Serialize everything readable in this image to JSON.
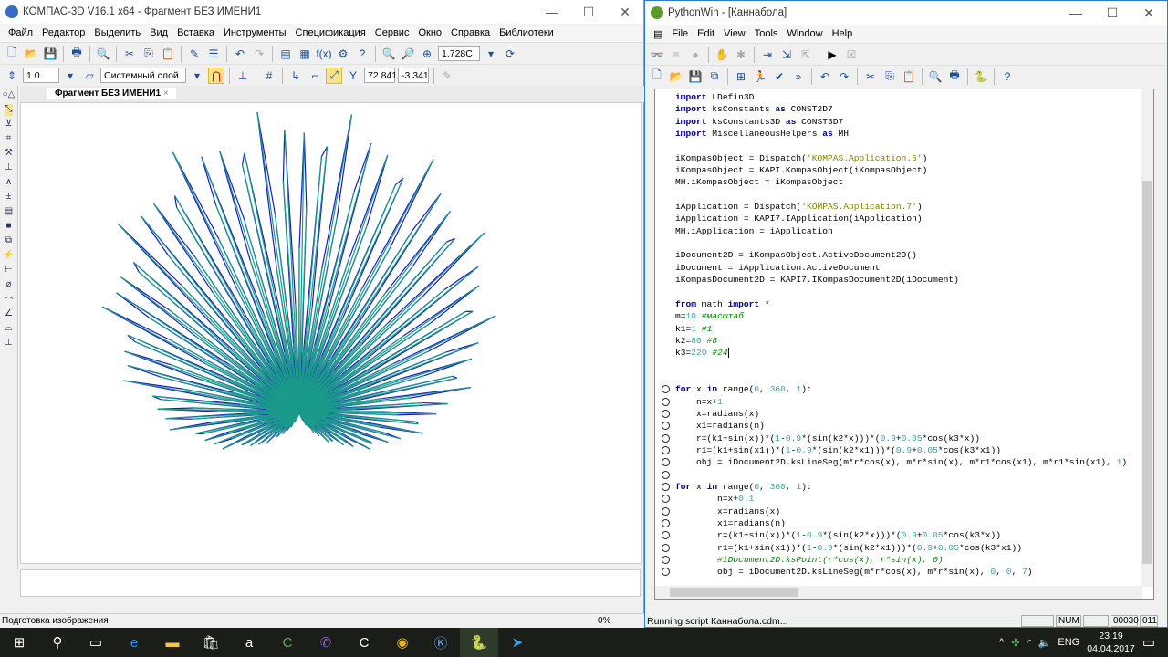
{
  "kompas": {
    "title": "КОМПАС-3D V16.1 x64 - Фрагмент БЕЗ ИМЕНИ1",
    "menu": [
      "Файл",
      "Редактор",
      "Выделить",
      "Вид",
      "Вставка",
      "Инструменты",
      "Спецификация",
      "Сервис",
      "Окно",
      "Справка",
      "Библиотеки"
    ],
    "zoom": "1.728С",
    "line_step": "1.0",
    "layer": "Системный слой",
    "coord_x": "72.841",
    "coord_y": "-3.341",
    "doc_tab": "Фрагмент БЕЗ ИМЕНИ1",
    "status": "Подготовка изображения",
    "progress": "0%",
    "colors": {
      "teal": "#1a9a8a",
      "blue": "#1a1ab8"
    }
  },
  "pywin": {
    "title": "PythonWin - [Каннабола]",
    "menu": [
      "File",
      "Edit",
      "View",
      "Tools",
      "Window",
      "Help"
    ],
    "status": "Running script Каннабола.cdm...",
    "panes": [
      "",
      "NUM",
      "",
      "00030",
      "011"
    ],
    "params": {
      "m": 10,
      "k1": 1,
      "k2": 80,
      "k3": 220
    },
    "code": [
      {
        "bp": false,
        "s": [
          [
            "kw",
            "import"
          ],
          [
            "pl",
            " LDefin3D"
          ]
        ]
      },
      {
        "bp": false,
        "s": [
          [
            "kw",
            "import"
          ],
          [
            "pl",
            " ksConstants "
          ],
          [
            "kw",
            "as"
          ],
          [
            "pl",
            " CONST2D7"
          ]
        ]
      },
      {
        "bp": false,
        "s": [
          [
            "kw",
            "import"
          ],
          [
            "pl",
            " ksConstants3D "
          ],
          [
            "kw",
            "as"
          ],
          [
            "pl",
            " CONST3D7"
          ]
        ]
      },
      {
        "bp": false,
        "s": [
          [
            "kw",
            "import"
          ],
          [
            "pl",
            " MiscellaneousHelpers "
          ],
          [
            "kw",
            "as"
          ],
          [
            "pl",
            " MH"
          ]
        ]
      },
      {
        "bp": false,
        "s": []
      },
      {
        "bp": false,
        "s": [
          [
            "pl",
            "iKompasObject = Dispatch("
          ],
          [
            "str",
            "'KOMPAS.Application.5'"
          ],
          [
            "pl",
            ")"
          ]
        ]
      },
      {
        "bp": false,
        "s": [
          [
            "pl",
            "iKompasObject = KAPI.KompasObject(iKompasObject)"
          ]
        ]
      },
      {
        "bp": false,
        "s": [
          [
            "pl",
            "MH.iKompasObject = iKompasObject"
          ]
        ]
      },
      {
        "bp": false,
        "s": []
      },
      {
        "bp": false,
        "s": [
          [
            "pl",
            "iApplication = Dispatch("
          ],
          [
            "str",
            "'KOMPAS.Application.7'"
          ],
          [
            "pl",
            ")"
          ]
        ]
      },
      {
        "bp": false,
        "s": [
          [
            "pl",
            "iApplication = KAPI7.IApplication(iApplication)"
          ]
        ]
      },
      {
        "bp": false,
        "s": [
          [
            "pl",
            "MH.iApplication = iApplication"
          ]
        ]
      },
      {
        "bp": false,
        "s": []
      },
      {
        "bp": false,
        "s": [
          [
            "pl",
            "iDocument2D = iKompasObject.ActiveDocument2D()"
          ]
        ]
      },
      {
        "bp": false,
        "s": [
          [
            "pl",
            "iDocument = iApplication.ActiveDocument"
          ]
        ]
      },
      {
        "bp": false,
        "s": [
          [
            "pl",
            "iKompasDocument2D = KAPI7.IKompasDocument2D(iDocument)"
          ]
        ]
      },
      {
        "bp": false,
        "s": []
      },
      {
        "bp": false,
        "s": [
          [
            "kw",
            "from"
          ],
          [
            "pl",
            " math "
          ],
          [
            "kw",
            "import"
          ],
          [
            "pl",
            " *"
          ]
        ]
      },
      {
        "bp": false,
        "s": [
          [
            "pl",
            "m="
          ],
          [
            "num",
            "10"
          ],
          [
            "pl",
            " "
          ],
          [
            "com",
            "#масштаб"
          ]
        ]
      },
      {
        "bp": false,
        "s": [
          [
            "pl",
            "k1="
          ],
          [
            "num",
            "1"
          ],
          [
            "pl",
            " "
          ],
          [
            "com",
            "#1"
          ]
        ]
      },
      {
        "bp": false,
        "s": [
          [
            "pl",
            "k2="
          ],
          [
            "num",
            "80"
          ],
          [
            "pl",
            " "
          ],
          [
            "com",
            "#8"
          ]
        ]
      },
      {
        "bp": false,
        "caret": true,
        "s": [
          [
            "pl",
            "k3="
          ],
          [
            "num",
            "220"
          ],
          [
            "pl",
            " "
          ],
          [
            "com",
            "#24"
          ]
        ]
      },
      {
        "bp": false,
        "s": []
      },
      {
        "bp": false,
        "s": []
      },
      {
        "bp": true,
        "s": [
          [
            "kw",
            "for"
          ],
          [
            "pl",
            " x "
          ],
          [
            "kw",
            "in"
          ],
          [
            "pl",
            " range("
          ],
          [
            "num",
            "0"
          ],
          [
            "pl",
            ", "
          ],
          [
            "num",
            "360"
          ],
          [
            "pl",
            ", "
          ],
          [
            "num",
            "1"
          ],
          [
            "pl",
            "):"
          ]
        ]
      },
      {
        "bp": true,
        "s": [
          [
            "pl",
            "    n=x+"
          ],
          [
            "num",
            "1"
          ]
        ]
      },
      {
        "bp": true,
        "s": [
          [
            "pl",
            "    x=radians(x)"
          ]
        ]
      },
      {
        "bp": true,
        "s": [
          [
            "pl",
            "    x1=radians(n)"
          ]
        ]
      },
      {
        "bp": true,
        "s": [
          [
            "pl",
            "    r=(k1+sin(x))*("
          ],
          [
            "num",
            "1"
          ],
          [
            "pl",
            "-"
          ],
          [
            "num",
            "0.9"
          ],
          [
            "pl",
            "*(sin(k2*x)))*("
          ],
          [
            "num",
            "0.9"
          ],
          [
            "pl",
            "+"
          ],
          [
            "num",
            "0.05"
          ],
          [
            "pl",
            "*cos(k3*x))"
          ]
        ]
      },
      {
        "bp": true,
        "s": [
          [
            "pl",
            "    r1=(k1+sin(x1))*("
          ],
          [
            "num",
            "1"
          ],
          [
            "pl",
            "-"
          ],
          [
            "num",
            "0.9"
          ],
          [
            "pl",
            "*(sin(k2*x1)))*("
          ],
          [
            "num",
            "0.9"
          ],
          [
            "pl",
            "+"
          ],
          [
            "num",
            "0.05"
          ],
          [
            "pl",
            "*cos(k3*x1))"
          ]
        ]
      },
      {
        "bp": true,
        "s": [
          [
            "pl",
            "    obj = iDocument2D.ksLineSeg(m*r*cos(x), m*r*sin(x), m*r1*cos(x1), m*r1*sin(x1), "
          ],
          [
            "num",
            "1"
          ],
          [
            "pl",
            ")"
          ]
        ]
      },
      {
        "bp": true,
        "s": []
      },
      {
        "bp": true,
        "s": [
          [
            "kw",
            "for"
          ],
          [
            "pl",
            " x "
          ],
          [
            "kw",
            "in"
          ],
          [
            "pl",
            " range("
          ],
          [
            "num",
            "0"
          ],
          [
            "pl",
            ", "
          ],
          [
            "num",
            "360"
          ],
          [
            "pl",
            ", "
          ],
          [
            "num",
            "1"
          ],
          [
            "pl",
            "):"
          ]
        ]
      },
      {
        "bp": true,
        "s": [
          [
            "pl",
            "        n=x+"
          ],
          [
            "num",
            "0.1"
          ]
        ]
      },
      {
        "bp": true,
        "s": [
          [
            "pl",
            "        x=radians(x)"
          ]
        ]
      },
      {
        "bp": true,
        "s": [
          [
            "pl",
            "        x1=radians(n)"
          ]
        ]
      },
      {
        "bp": true,
        "s": [
          [
            "pl",
            "        r=(k1+sin(x))*("
          ],
          [
            "num",
            "1"
          ],
          [
            "pl",
            "-"
          ],
          [
            "num",
            "0.9"
          ],
          [
            "pl",
            "*(sin(k2*x)))*("
          ],
          [
            "num",
            "0.9"
          ],
          [
            "pl",
            "+"
          ],
          [
            "num",
            "0.05"
          ],
          [
            "pl",
            "*cos(k3*x))"
          ]
        ]
      },
      {
        "bp": true,
        "s": [
          [
            "pl",
            "        r1=(k1+sin(x1))*("
          ],
          [
            "num",
            "1"
          ],
          [
            "pl",
            "-"
          ],
          [
            "num",
            "0.9"
          ],
          [
            "pl",
            "*(sin(k2*x1)))*("
          ],
          [
            "num",
            "0.9"
          ],
          [
            "pl",
            "+"
          ],
          [
            "num",
            "0.05"
          ],
          [
            "pl",
            "*cos(k3*x1))"
          ]
        ]
      },
      {
        "bp": true,
        "s": [
          [
            "com",
            "        #iDocument2D.ksPoint(r*cos(x), r*sin(x), 0)"
          ]
        ]
      },
      {
        "bp": true,
        "s": [
          [
            "pl",
            "        obj = iDocument2D.ksLineSeg(m*r*cos(x), m*r*sin(x), "
          ],
          [
            "num",
            "0"
          ],
          [
            "pl",
            ", "
          ],
          [
            "num",
            "0"
          ],
          [
            "pl",
            ", "
          ],
          [
            "num",
            "7"
          ],
          [
            "pl",
            ")"
          ]
        ]
      }
    ]
  },
  "taskbar": {
    "lang": "ENG",
    "time": "23:19",
    "date": "04.04.2017"
  }
}
